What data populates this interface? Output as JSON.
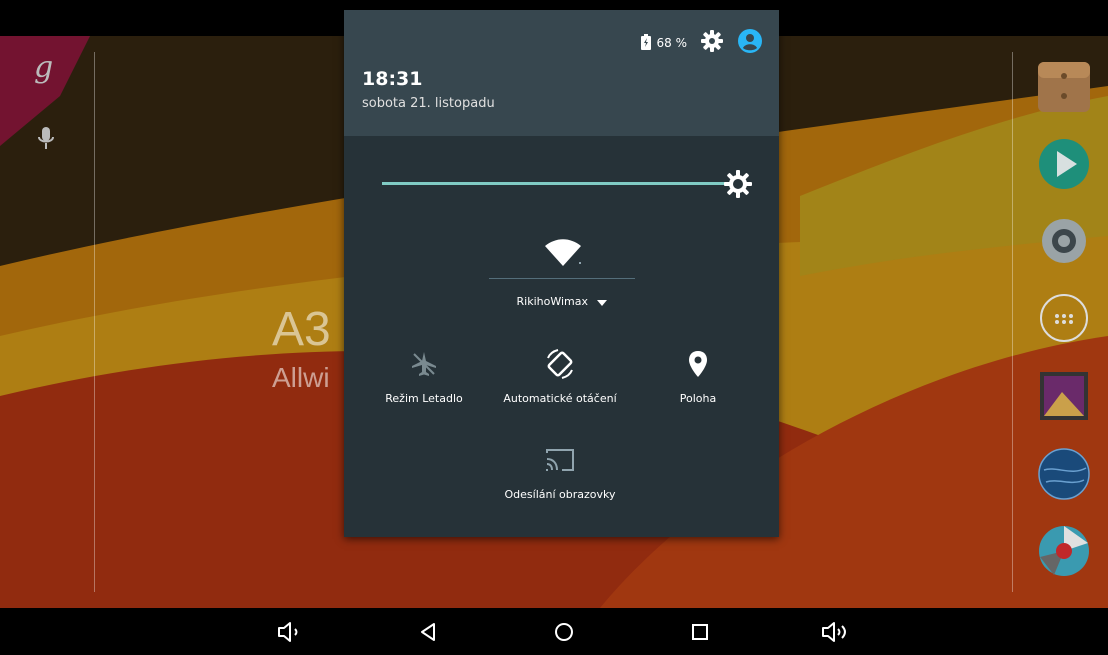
{
  "status": {
    "battery_text": "68 %",
    "settings_icon": "gear-icon",
    "user_icon": "account-icon"
  },
  "header": {
    "time": "18:31",
    "date": "sobota 21. listopadu"
  },
  "brightness": {
    "level": 1.0,
    "icon": "brightness-icon"
  },
  "wifi": {
    "network": "RikihoWimax",
    "icon": "wifi-icon"
  },
  "tiles": [
    {
      "label": "Režim Letadlo",
      "icon": "airplane-icon"
    },
    {
      "label": "Automatické otáčení",
      "icon": "auto-rotate-icon"
    },
    {
      "label": "Poloha",
      "icon": "location-icon"
    },
    {
      "label": "Odesílání obrazovky",
      "icon": "cast-icon"
    }
  ],
  "wallpaper_text": {
    "title": "A3",
    "subtitle": "Allwi"
  },
  "colors": {
    "accent": "#80cbc4",
    "shade_bg": "#263238",
    "shade_header": "#37474f",
    "account_blue": "#29b6f6"
  }
}
